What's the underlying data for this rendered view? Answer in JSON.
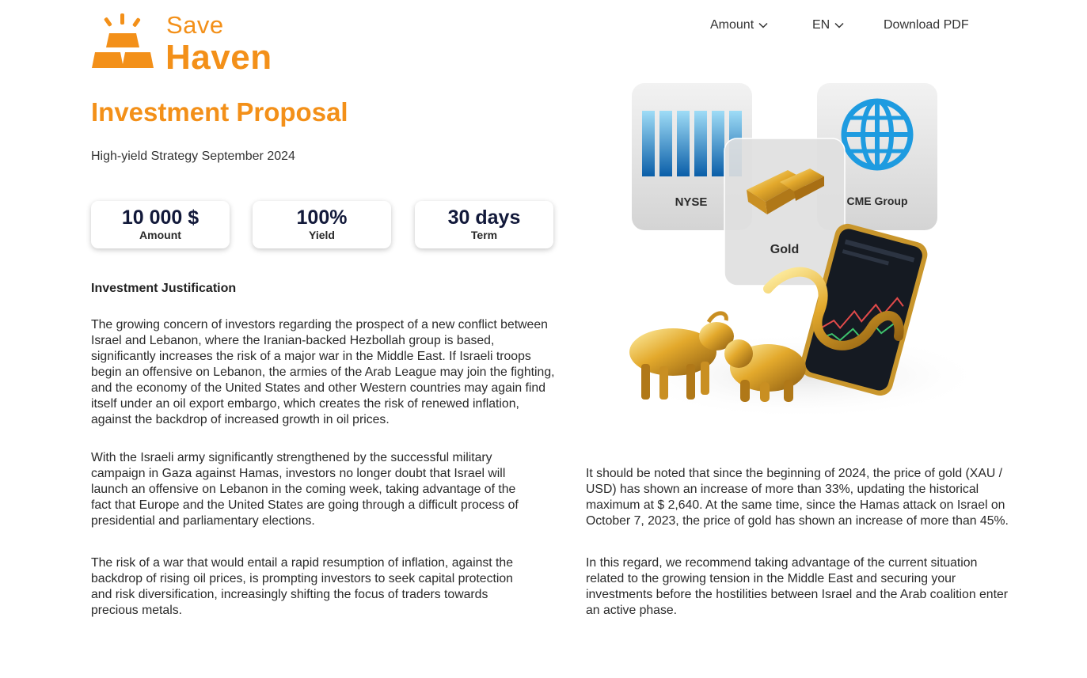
{
  "brand": {
    "line1": "Save",
    "line2": "Haven",
    "color": "#f39019"
  },
  "nav": {
    "amount_label": "Amount",
    "lang_label": "EN",
    "download_label": "Download PDF"
  },
  "header": {
    "title": "Investment Proposal",
    "subtitle": "High-yield Strategy September 2024"
  },
  "stats": [
    {
      "value": "10 000 $",
      "label": "Amount"
    },
    {
      "value": "100%",
      "label": "Yield"
    },
    {
      "value": "30 days",
      "label": "Term"
    }
  ],
  "hero": {
    "card_nyse": "NYSE",
    "card_cme": "CME Group",
    "card_gold": "Gold"
  },
  "justification": {
    "heading": "Investment Justification",
    "paragraphs": [
      "The growing concern of investors regarding the prospect of a new conflict between Israel and Lebanon, where the Iranian-backed Hezbollah group is based, significantly increases the risk of a major war in the Middle East. If Israeli troops begin an offensive on Lebanon, the armies of the Arab League may join the fighting, and the economy of the United States and other Western countries may again find itself under an oil export embargo, which creates the risk of renewed inflation, against the backdrop of increased growth in oil prices.",
      "With the Israeli army significantly strengthened by the successful military campaign in Gaza against Hamas, investors no longer doubt that Israel will launch an offensive on Lebanon in the coming week, taking advantage of the fact that Europe and the United States are going through a difficult process of presidential and parliamentary elections.",
      "The risk of a war that would entail a rapid resumption of inflation, against the backdrop of rising oil prices, is prompting investors to seek capital protection and risk diversification, increasingly shifting the focus of traders towards precious metals.",
      "It should be noted that since the beginning of 2024, the price of gold (XAU / USD) has shown an increase of more than 33%, updating the historical maximum at $ 2,640. At the same time, since the Hamas attack on Israel on October 7, 2023, the price of gold has shown an increase of more than 45%.",
      "In this regard, we recommend taking advantage of the current situation related to the growing tension in the Middle East and securing your investments before the hostilities between Israel and the Arab coalition enter an active phase."
    ]
  }
}
